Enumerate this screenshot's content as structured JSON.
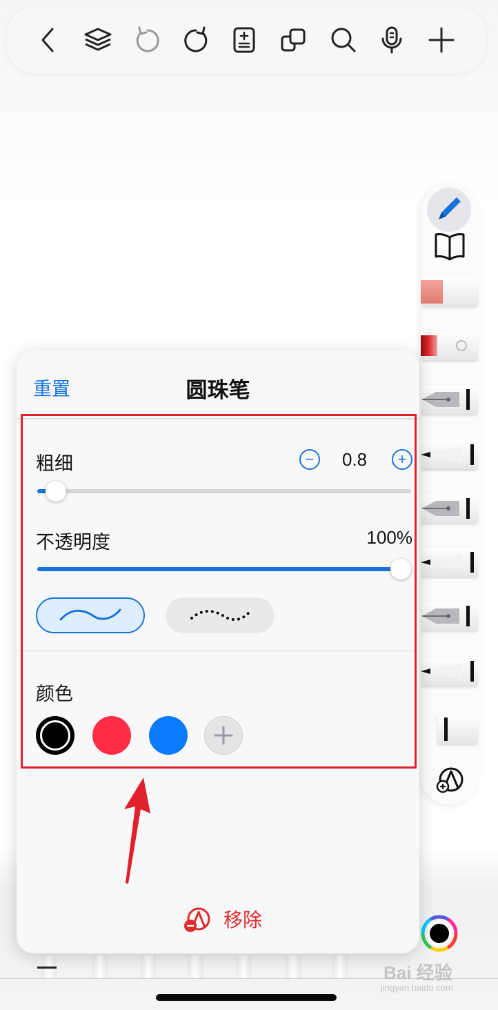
{
  "panel": {
    "reset_label": "重置",
    "title": "圆珠笔",
    "thickness": {
      "label": "粗细",
      "value": "0.8",
      "fraction": 0.05
    },
    "opacity": {
      "label": "不透明度",
      "value": "100%",
      "fraction": 1.0
    },
    "stroke_styles": [
      "smooth-line",
      "dotted-line"
    ],
    "selected_style": "smooth-line",
    "color_section_label": "颜色",
    "colors": [
      "#000000",
      "#ff2d46",
      "#0a7aff"
    ],
    "selected_color": "#000000",
    "remove_label": "移除"
  },
  "toolbar_icons": [
    "back-icon",
    "layers-icon",
    "undo-icon",
    "redo-icon",
    "add-page-icon",
    "copy-icon",
    "search-icon",
    "microphone-icon",
    "add-icon"
  ],
  "tool_strip_icons": [
    "pencil-icon",
    "book-icon",
    "eraser-tool",
    "highlighter-tool",
    "fountain-pen-tool",
    "ballpoint-tool",
    "fountain-pen-tool-2",
    "ballpoint-tool-2",
    "fountain-pen-tool-3",
    "ballpoint-tool-3",
    "marker-tool",
    "add-tool-icon"
  ],
  "accent_color": "#1a73d9",
  "watermark": {
    "main": "Bai 经验",
    "sub": "jingyan.baidu.com"
  }
}
